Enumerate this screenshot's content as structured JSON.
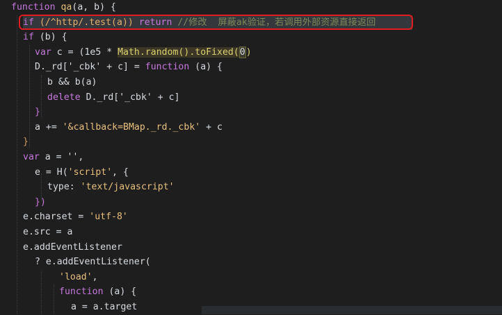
{
  "editor": {
    "lines": [
      [
        "function",
        " ",
        "qa",
        "(a, b) {"
      ],
      [
        "if",
        " (/^",
        "http",
        "/.test(a)) ",
        "return",
        " //修改  屏蔽ak验证，若调用外部资源直接返回"
      ],
      [
        "if",
        " (b) {"
      ],
      [
        "var",
        " c = (1e5 * ",
        "Math",
        ".random().toFixed(",
        "0",
        ")"
      ],
      [
        "D._rd['_cbk' + c] = ",
        "function",
        " (a) {"
      ],
      [
        "b && b(a)"
      ],
      [
        "delete",
        " D._rd['_cbk' + c]"
      ],
      [
        "}"
      ],
      [
        "a += ",
        "'&callback=BMap._rd._cbk'",
        " + c"
      ],
      [
        "}"
      ],
      [
        "var",
        " a = '',"
      ],
      [
        "e = H(",
        "'script'",
        ", {"
      ],
      [
        "type: ",
        "'text/javascript'"
      ],
      [
        "})"
      ],
      [
        "e.charset = ",
        "'utf-8'"
      ],
      [
        "e.src = a"
      ],
      [
        "e.addEventListener"
      ],
      [
        "? e.addEventListener("
      ],
      [
        "'load'",
        ","
      ],
      [
        "function",
        " (a) {"
      ],
      [
        "a = a.target"
      ]
    ]
  },
  "annotation": {
    "comment_text": "//修改  屏蔽ak验证，若调用外部资源直接返回",
    "highlight_color": "#e11d1d"
  },
  "colors": {
    "background": "#1e1e1e",
    "keyword": "#c678dd",
    "string": "#e8c07d",
    "comment": "#7a8b5a",
    "text": "#d7dce2"
  }
}
